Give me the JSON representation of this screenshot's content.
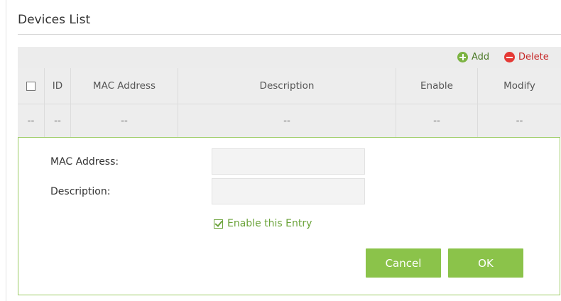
{
  "section": {
    "title": "Devices List"
  },
  "toolbar": {
    "add_label": "Add",
    "delete_label": "Delete"
  },
  "table": {
    "columns": [
      "",
      "ID",
      "MAC Address",
      "Description",
      "Enable",
      "Modify"
    ],
    "rows": [
      [
        "--",
        "--",
        "--",
        "--",
        "--",
        "--"
      ]
    ]
  },
  "form": {
    "mac_label": "MAC Address:",
    "mac_value": "",
    "description_label": "Description:",
    "description_value": "",
    "enable_label": "Enable this Entry",
    "enable_checked": true,
    "cancel_label": "Cancel",
    "ok_label": "OK"
  },
  "colors": {
    "accent": "#8bc34a",
    "add": "#7cb342",
    "delete": "#e53935",
    "panel_border": "#9ccc65"
  }
}
